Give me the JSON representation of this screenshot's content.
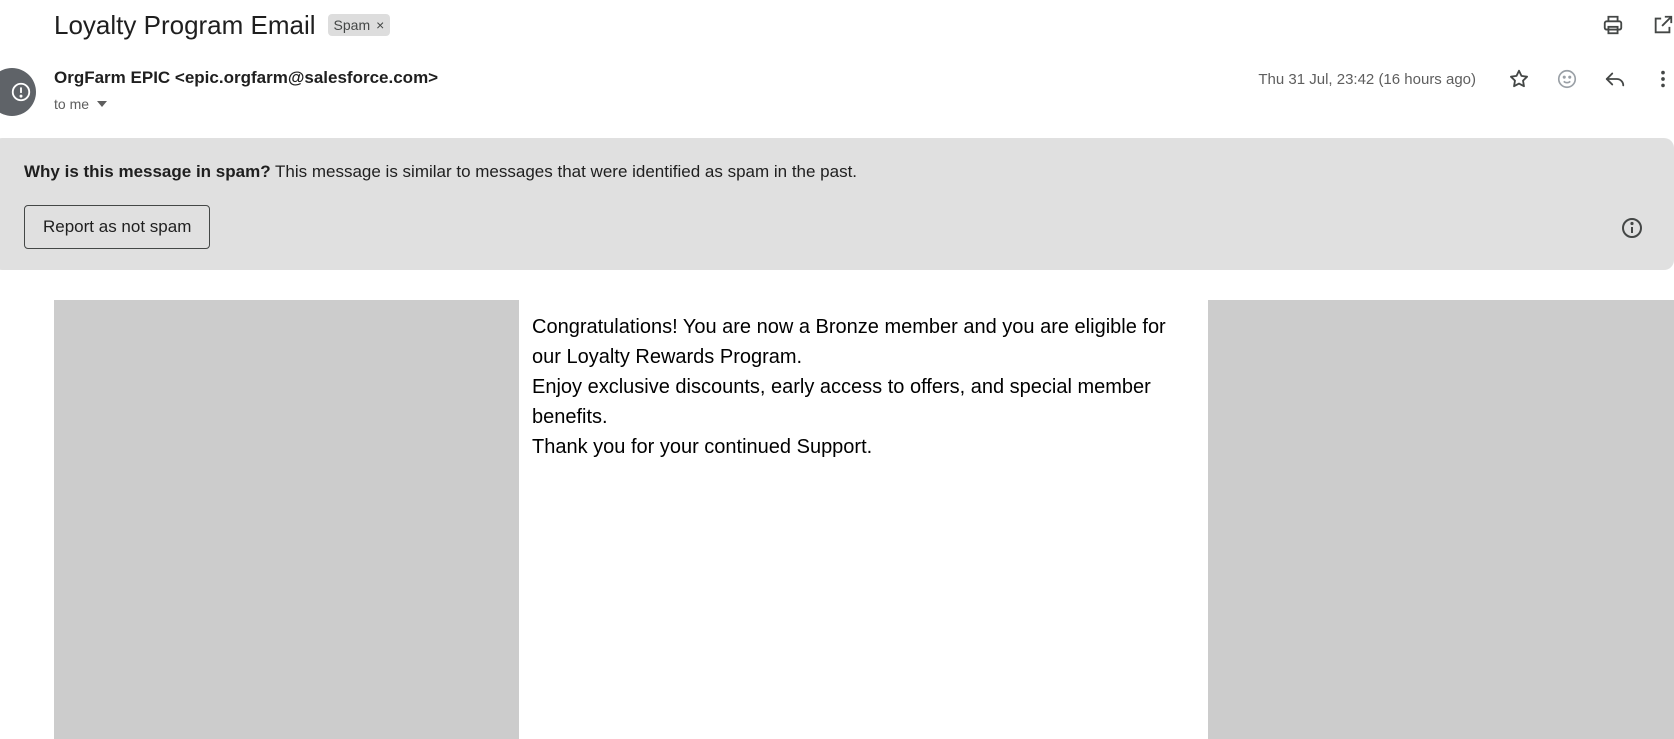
{
  "email": {
    "subject": "Loyalty Program Email",
    "label": "Spam",
    "label_remove": "×",
    "sender": "OrgFarm EPIC <epic.orgfarm@salesforce.com>",
    "recipient": "to me",
    "date": "Thu 31 Jul, 23:42 (16 hours ago)"
  },
  "spam_banner": {
    "question": "Why is this message in spam?",
    "explanation": " This message is similar to messages that were identified as spam in the past.",
    "button_label": "Report as not spam"
  },
  "body": {
    "lines": [
      "Congratulations! You are now a Bronze member and you are eligible for our Loyalty Rewards Program.",
      "Enjoy exclusive discounts, early access to offers, and special member benefits.",
      "Thank you for your continued Support."
    ]
  },
  "icons": {
    "top": [
      "print-icon",
      "open-in-new-window-icon"
    ],
    "actions": [
      "star-icon",
      "emoji-react-icon",
      "reply-icon",
      "more-vert-icon"
    ],
    "avatar": "alert-icon",
    "info": "info-icon"
  },
  "colors": {
    "banner_bg": "#e0e0e0",
    "placeholder_gray": "#cccccc",
    "avatar_bg": "#5f6368",
    "chip_bg": "#dddddd"
  }
}
